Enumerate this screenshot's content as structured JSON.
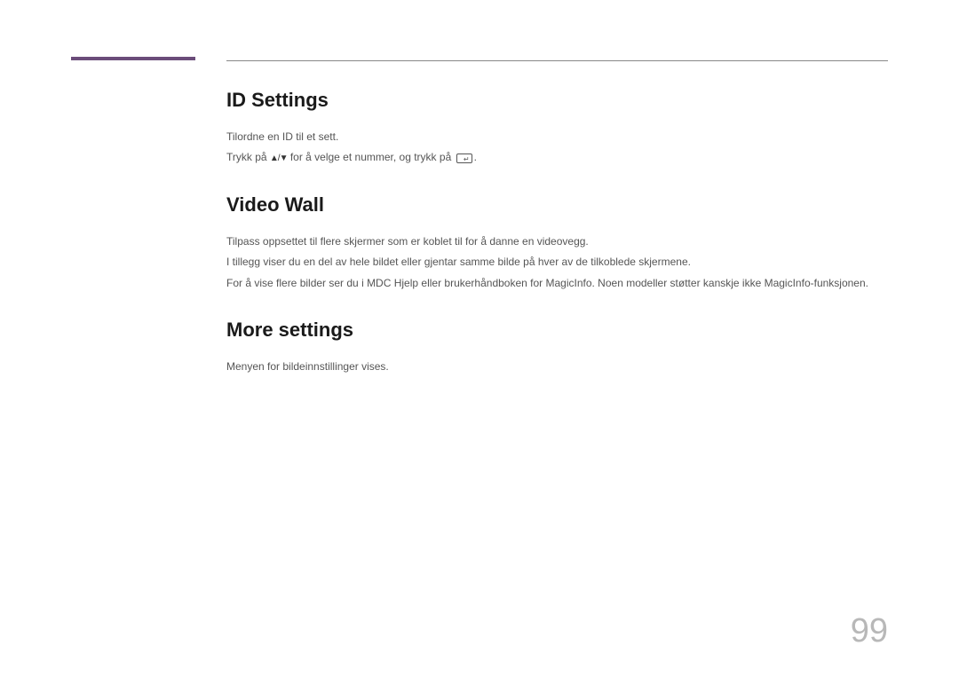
{
  "sections": {
    "id_settings": {
      "heading": "ID Settings",
      "line1": "Tilordne en ID til et sett.",
      "line2_a": "Trykk på ",
      "line2_b": " for å velge et nummer, og trykk på ",
      "line2_c": "."
    },
    "video_wall": {
      "heading": "Video Wall",
      "line1": "Tilpass oppsettet til flere skjermer som er koblet til for å danne en videovegg.",
      "line2": "I tillegg viser du en del av hele bildet eller gjentar samme bilde på hver av de tilkoblede skjermene.",
      "line3": "For å vise flere bilder ser du i MDC Hjelp eller brukerhåndboken for MagicInfo. Noen modeller støtter kanskje ikke MagicInfo-funksjonen."
    },
    "more_settings": {
      "heading": "More settings",
      "line1": "Menyen for bildeinnstillinger vises."
    }
  },
  "page_number": "99"
}
